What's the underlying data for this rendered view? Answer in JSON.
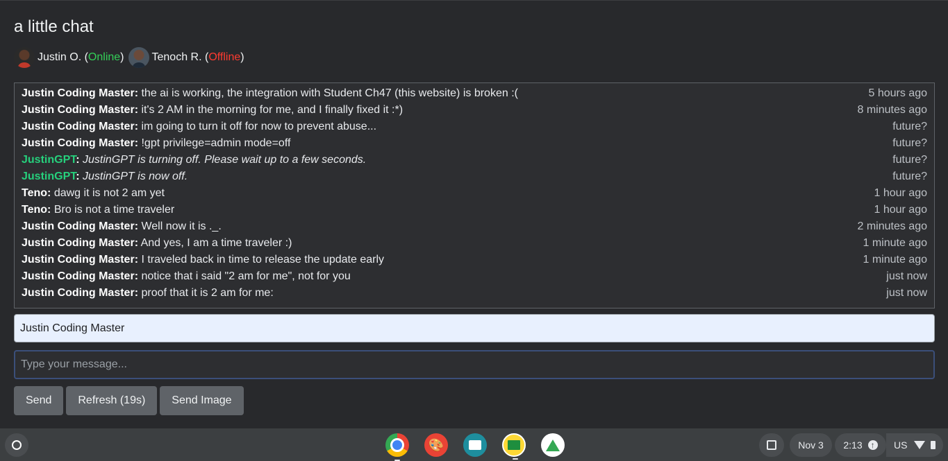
{
  "page": {
    "title": "a little chat"
  },
  "users": [
    {
      "name": "Justin O.",
      "status": "Online"
    },
    {
      "name": "Tenoch R.",
      "status": "Offline"
    }
  ],
  "messages": [
    {
      "author": "Justin Coding Master",
      "text": "the ai is working, the integration with Student Ch47 (this website) is broken :(",
      "time": "5 hours ago"
    },
    {
      "author": "Justin Coding Master",
      "text": "it's 2 AM in the morning for me, and I finally fixed it :*)",
      "time": "8 minutes ago"
    },
    {
      "author": "Justin Coding Master",
      "text": "im going to turn it off for now to prevent abuse...",
      "time": "future?"
    },
    {
      "author": "Justin Coding Master",
      "text": "!gpt privilege=admin mode=off",
      "time": "future?"
    },
    {
      "author": "JustinGPT",
      "text": "JustinGPT is turning off. Please wait up to a few seconds.",
      "time": "future?"
    },
    {
      "author": "JustinGPT",
      "text": "JustinGPT is now off.",
      "time": "future?"
    },
    {
      "author": "Teno",
      "text": "dawg it is not 2 am yet",
      "time": "1 hour ago"
    },
    {
      "author": "Teno",
      "text": "Bro is not a time traveler",
      "time": "1 hour ago"
    },
    {
      "author": "Justin Coding Master",
      "text": "Well now it is ._.",
      "time": "2 minutes ago"
    },
    {
      "author": "Justin Coding Master",
      "text": "And yes, I am a time traveler :)",
      "time": "1 minute ago"
    },
    {
      "author": "Justin Coding Master",
      "text": "I traveled back in time to release the update early",
      "time": "1 minute ago"
    },
    {
      "author": "Justin Coding Master",
      "text": "notice that i said \"2 am for me\", not for you",
      "time": "just now"
    },
    {
      "author": "Justin Coding Master",
      "text": "proof that it is 2 am for me:",
      "time": "just now"
    }
  ],
  "form": {
    "name_value": "Justin Coding Master",
    "message_placeholder": "Type your message...",
    "send_label": "Send",
    "refresh_label": "Refresh (19s)",
    "send_image_label": "Send Image"
  },
  "shelf": {
    "apps": [
      "chrome-icon",
      "canvas-icon",
      "news-icon",
      "classroom-icon",
      "drive-icon"
    ],
    "date": "Nov 3",
    "time": "2:13",
    "keyboard_layout": "US"
  },
  "colors": {
    "online": "#34d058",
    "offline": "#ff3b30",
    "bot_author": "#26d07c"
  }
}
